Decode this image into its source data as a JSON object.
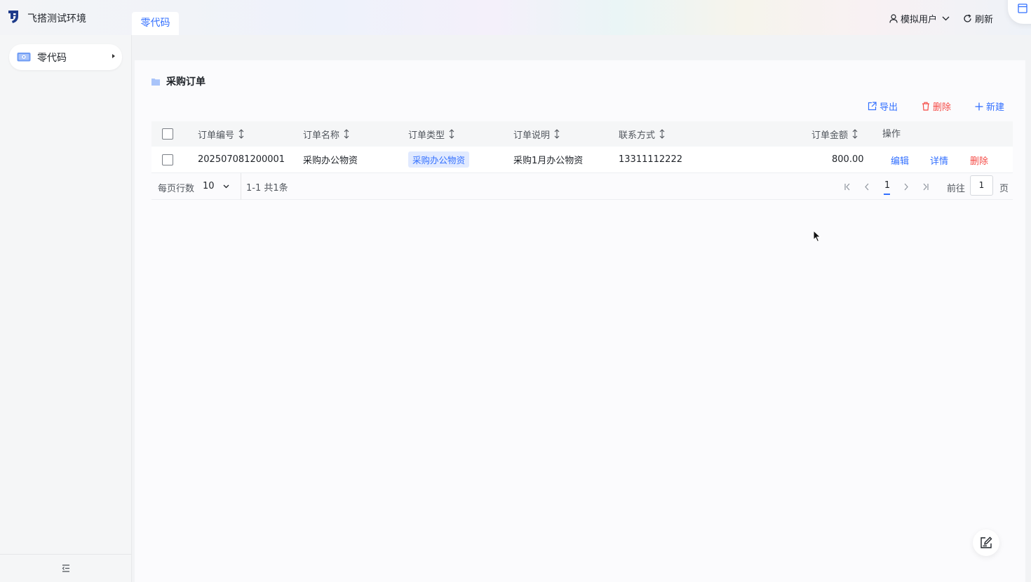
{
  "app": {
    "title": "飞搭测试环境"
  },
  "top_tabs": [
    {
      "label": "零代码"
    }
  ],
  "header": {
    "user_label": "模拟用户",
    "refresh_label": "刷新"
  },
  "sidebar": {
    "items": [
      {
        "label": "零代码",
        "icon": "screen-app-icon"
      }
    ]
  },
  "page": {
    "title": "采购订单",
    "toolbar": {
      "export_label": "导出",
      "delete_label": "删除",
      "new_label": "新建"
    }
  },
  "table": {
    "columns": [
      "订单编号",
      "订单名称",
      "订单类型",
      "订单说明",
      "联系方式",
      "订单金额",
      "操作"
    ],
    "rows": [
      {
        "order_no": "202507081200001",
        "name": "采购办公物资",
        "type": "采购办公物资",
        "description": "采购1月办公物资",
        "contact": "13311112222",
        "amount": "800.00",
        "actions": [
          "编辑",
          "详情",
          "删除"
        ]
      }
    ]
  },
  "pagination": {
    "rows_per_page_label": "每页行数",
    "page_size": "10",
    "range_text": "1-1 共1条",
    "current_page": "1",
    "goto_label": "前往",
    "goto_value": "1",
    "page_suffix": "页"
  },
  "colors": {
    "accent": "#3370ff",
    "danger": "#f54a45",
    "tag_bg": "#e1eaff"
  }
}
